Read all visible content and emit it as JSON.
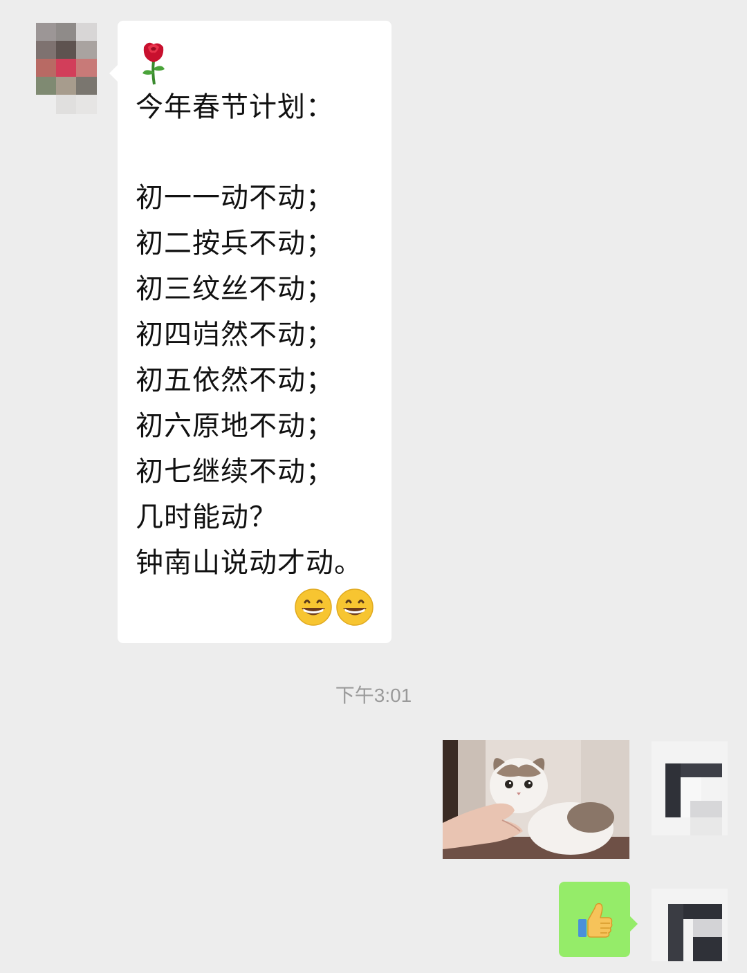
{
  "conversation": {
    "incoming_message": {
      "rose_emoji": "rose-emoji",
      "lines": [
        "今年春节计划：",
        "",
        "初一一动不动；",
        "初二按兵不动；",
        "初三纹丝不动；",
        "初四岿然不动；",
        "初五依然不动；",
        "初六原地不动；",
        "初七继续不动；",
        "几时能动？",
        "钟南山说动才动。"
      ],
      "trailing_emojis": [
        "grinning-face-emoji",
        "grinning-face-emoji"
      ]
    },
    "timestamp": "下午3:01",
    "outgoing_messages": [
      {
        "type": "image",
        "subject": "cat-photo"
      },
      {
        "type": "sticker",
        "icon": "thumbs-up-emoji"
      }
    ]
  },
  "colors": {
    "chat_background": "#ededed",
    "incoming_bubble": "#ffffff",
    "outgoing_bubble": "#95ec69",
    "timestamp_text": "#9a9a9a"
  }
}
